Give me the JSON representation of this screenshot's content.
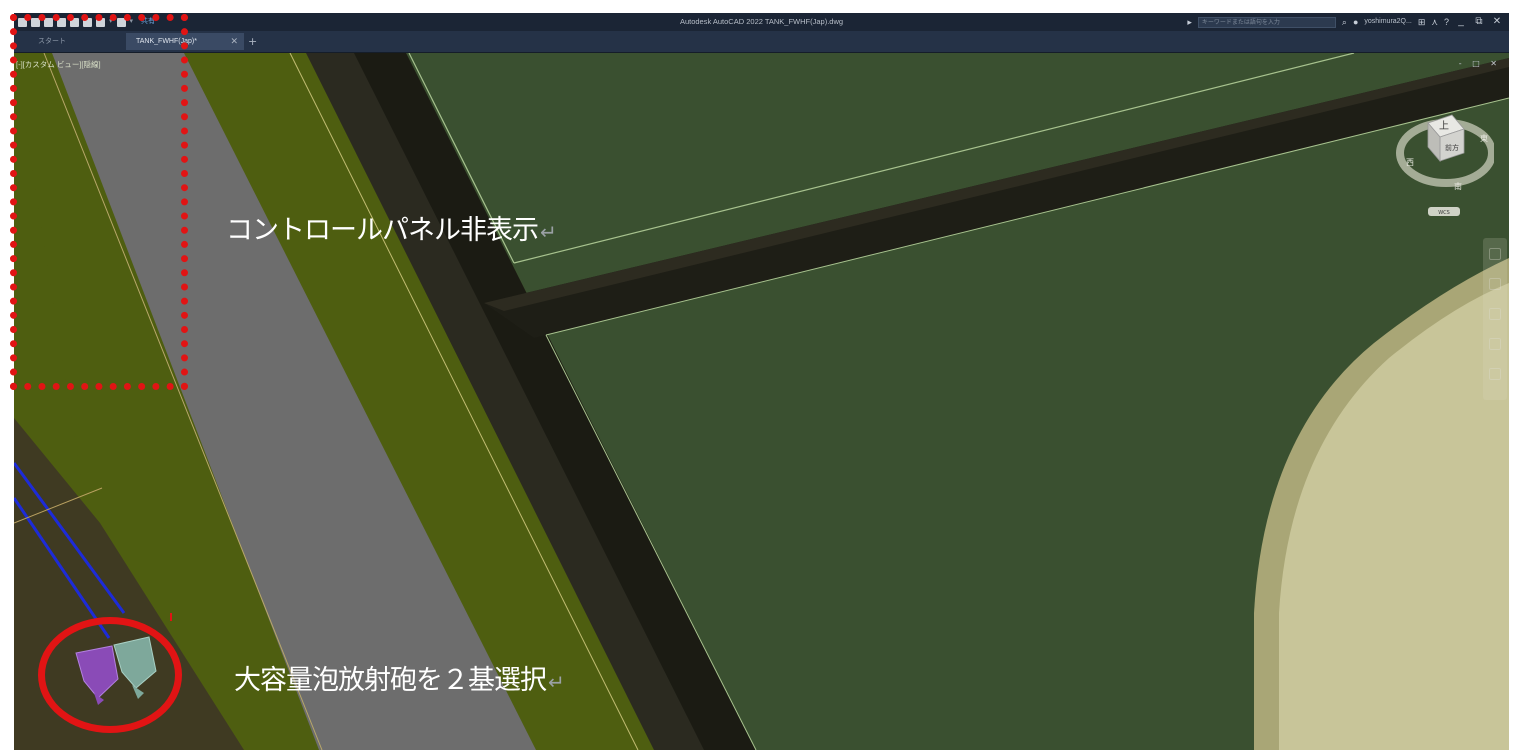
{
  "window": {
    "title": "Autodesk AutoCAD 2022   TANK_FWHF(Jap).dwg",
    "search_placeholder": "キーワードまたは語句を入力",
    "share_label": "共有",
    "user": "yoshimura2Q...",
    "window_controls": [
      "_",
      "⧉",
      "✕"
    ]
  },
  "tabs": [
    {
      "label": "スタート",
      "active": false
    },
    {
      "label": "TANK_FWHF(Jap)*",
      "active": true,
      "close": "✕"
    }
  ],
  "tab_add": "+",
  "viewport": {
    "label": "[-][カスタム ビュー][隠線]",
    "controls": "- □ ✕",
    "viewcube": {
      "top": "上",
      "front": "前方",
      "west": "西",
      "south": "南",
      "east": "東",
      "wcs": "WCS"
    }
  },
  "annotations": {
    "hide_control_panel": "コントロールパネル非表示",
    "select_cannons": "大容量泡放射砲を２基選択",
    "return_mark": "↵"
  },
  "colors": {
    "annotation_red": "#e11414",
    "titlebar": "#1b2535",
    "tabbar": "#253247",
    "ground_green": "#3a5030",
    "grass_olive": "#4e5e10",
    "road_gray": "#6d6d6d",
    "tank_beige": "#c8c599",
    "cannon_purple": "#8a4bb7",
    "cannon_teal": "#7ea89b"
  },
  "icons": [
    "save-icon",
    "open-icon",
    "undo-icon",
    "redo-icon",
    "search-icon",
    "user-icon",
    "cart-icon",
    "autodesk-icon",
    "help-icon",
    "viewcube-icon",
    "navigation-bar-icon"
  ]
}
